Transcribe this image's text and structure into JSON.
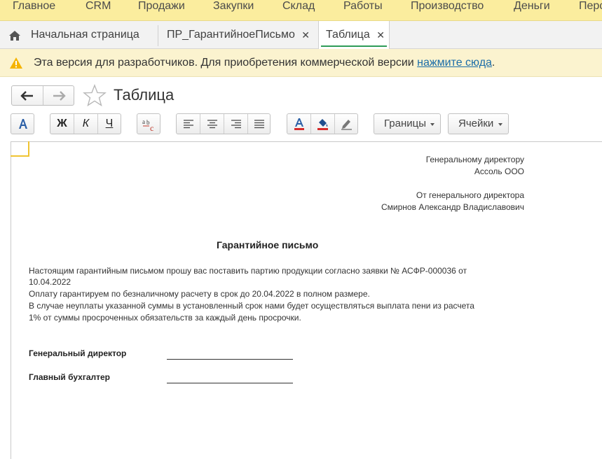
{
  "top_menu": [
    "Главное",
    "CRM",
    "Продажи",
    "Закупки",
    "Склад",
    "Работы",
    "Производство",
    "Деньги",
    "Перс"
  ],
  "tabs": {
    "home_label": "Начальная страница",
    "tab2_label": "ПР_ГарантийноеПисьмо",
    "tab3_label": "Таблица",
    "close_glyph": "✕"
  },
  "banner": {
    "text": "Эта версия для разработчиков. Для приобретения коммерческой версии ",
    "link": "нажмите сюда",
    "tail": "."
  },
  "page": {
    "title": "Таблица"
  },
  "toolbar": {
    "bold": "Ж",
    "italic": "К",
    "underline": "Ч",
    "borders": "Границы",
    "cells": "Ячейки"
  },
  "colors": {
    "accent": "#2e9b57",
    "menu_bg": "#fbed9e",
    "banner_bg": "#fbf3cf",
    "link": "#1a6ca8",
    "cell_mark": "#f0c432"
  },
  "document": {
    "to_line1": "Генеральному директору",
    "to_line2": "Ассоль ООО",
    "from_line1": "От генерального директора",
    "from_line2": "Смирнов Александр Владиславович",
    "heading": "Гарантийное письмо",
    "body": [
      "Настоящим гарантийным письмом прошу вас поставить партию продукции согласно заявки № АСФР-000036 от",
      "10.04.2022",
      "Оплату гарантируем по безналичному расчету в срок до 20.04.2022 в полном размере.",
      "В случае неуплаты указанной суммы в установленный срок нами будет осуществляться выплата пени из расчета",
      "1% от суммы просроченных обязательств за каждый день просрочки."
    ],
    "sign1": "Генеральный директор",
    "sign2": "Главный бухгалтер"
  }
}
